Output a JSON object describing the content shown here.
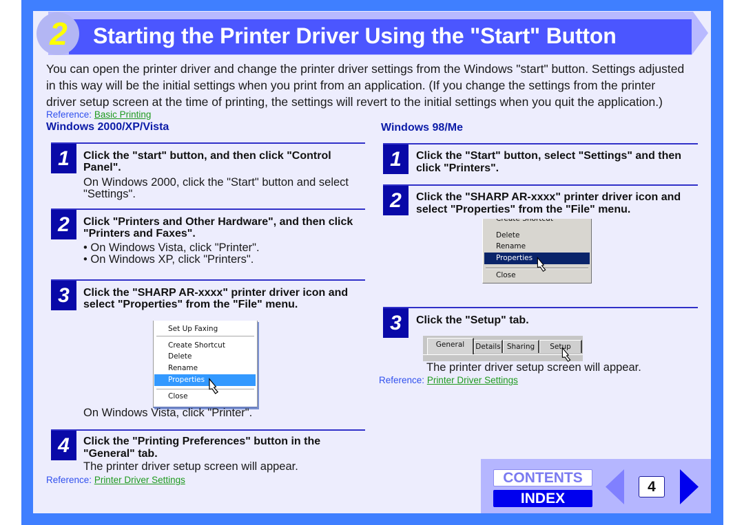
{
  "header": {
    "section_number": "2",
    "title": "Starting the Printer Driver Using the \"Start\" Button"
  },
  "intro": {
    "lines": [
      "You can open the printer driver and change the printer driver settings from the Windows \"start\" button. Settings adjusted",
      "in this way will be the initial settings when you print from an application. (If you change the settings from the printer",
      "driver setup screen at the time of printing, the settings will revert to the initial settings when you quit the application.)"
    ],
    "reference": {
      "label": "Reference:",
      "link": "Basic Printing"
    }
  },
  "win2000": {
    "heading": "Windows 2000/XP/Vista",
    "steps": [
      {
        "number": "1",
        "title_lines": [
          "Click the \"start\" button, and then click \"Control",
          "Panel\"."
        ],
        "body_lines": [
          "On Windows 2000, click the \"Start\" button and select",
          "\"Settings\"."
        ]
      },
      {
        "number": "2",
        "title_lines": [
          "Click \"Printers and Other Hardware\", and then click",
          "\"Printers and Faxes\"."
        ],
        "bullets": [
          "• On Windows Vista, click \"Printer\".",
          "• On Windows XP, click \"Printers\"."
        ]
      },
      {
        "number": "3",
        "title_lines": [
          "Click the \"SHARP AR-xxxx\" printer driver icon and",
          "select \"Properties\" from the \"File\" menu."
        ],
        "menu": {
          "items": [
            "Set Up Faxing",
            "Create Shortcut",
            "Delete",
            "Rename",
            "Properties",
            "Close"
          ],
          "selected": "Properties"
        },
        "note": "On Windows Vista, click \"Printer\"."
      },
      {
        "number": "4",
        "title_lines": [
          "Click the \"Printing Preferences\" button in the",
          "\"General\" tab."
        ],
        "body": "The printer driver setup screen will appear."
      }
    ],
    "reference": {
      "label": "Reference:",
      "link": "Printer Driver Settings"
    }
  },
  "win98": {
    "heading": "Windows 98/Me",
    "steps": [
      {
        "number": "1",
        "title_lines": [
          "Click the \"Start\" button, select \"Settings\" and then",
          "click \"Printers\"."
        ]
      },
      {
        "number": "2",
        "title_lines": [
          "Click the \"SHARP AR-xxxx\" printer driver icon and",
          "select \"Properties\" from the \"File\" menu."
        ],
        "menu": {
          "items": [
            "Create Shortcut",
            "Delete",
            "Rename",
            "Properties",
            "Close"
          ],
          "selected": "Properties"
        }
      },
      {
        "number": "3",
        "title_lines": [
          "Click the \"Setup\" tab."
        ],
        "tabs": [
          "General",
          "Details",
          "Sharing",
          "Setup"
        ],
        "active_tab": "General",
        "body": "The printer driver setup screen will appear."
      }
    ],
    "reference": {
      "label": "Reference:",
      "link": "Printer Driver Settings"
    }
  },
  "nav": {
    "contents_label": "CONTENTS",
    "index_label": "INDEX",
    "page_number": "4",
    "prev_icon": "triangle-left-icon",
    "next_icon": "triangle-right-icon"
  },
  "colors": {
    "frame": "#3f7fff",
    "content_bg": "#ededfd",
    "title_bar": "#4b56ff",
    "step_box": "#0909a8",
    "heading": "#0c1ca8",
    "reference": "#3050ee",
    "link": "#1f9a1f",
    "section_number": "#ffff00"
  }
}
